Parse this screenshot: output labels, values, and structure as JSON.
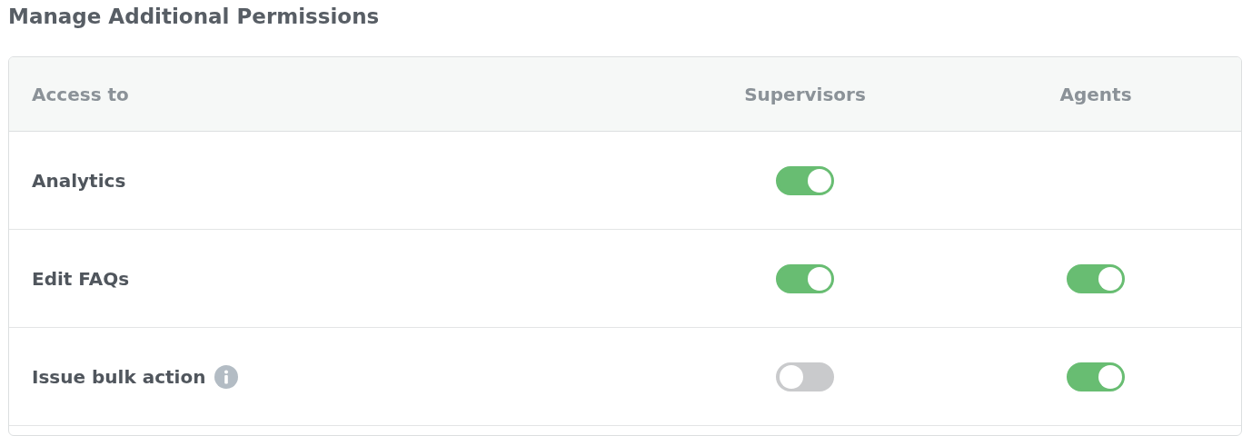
{
  "title": "Manage Additional Permissions",
  "columns": [
    "Access to",
    "Supervisors",
    "Agents"
  ],
  "rows": [
    {
      "label": "Analytics",
      "info": false,
      "supervisors_on": true
    },
    {
      "label": "Edit FAQs",
      "info": false,
      "supervisors_on": true,
      "agents_on": true
    },
    {
      "label": "Issue bulk action",
      "info": true,
      "supervisors_on": false,
      "agents_on": true
    }
  ]
}
